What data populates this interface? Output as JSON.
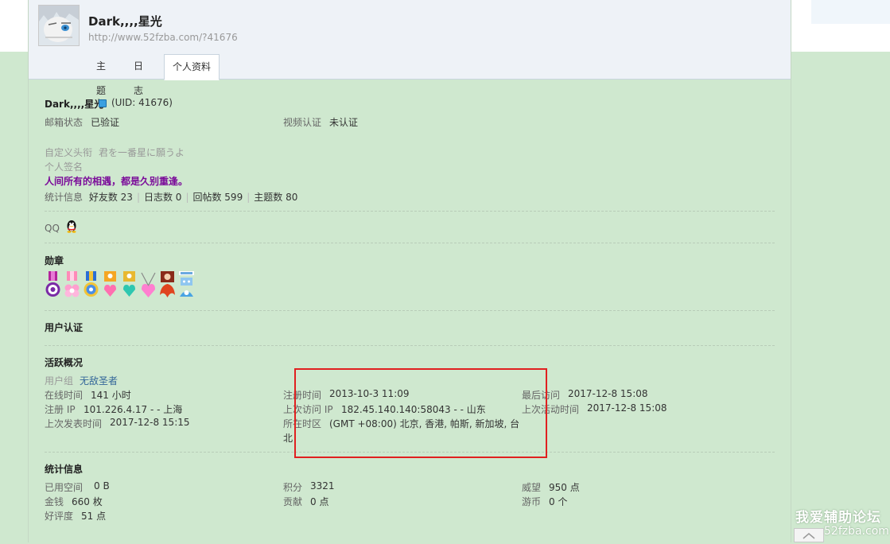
{
  "profile": {
    "name": "Dark,,,,星光",
    "url": "http://www.52fzba.com/?41676",
    "uid_text": "(UID: 41676)"
  },
  "tabs": [
    {
      "label": "主题"
    },
    {
      "label": "日志"
    },
    {
      "label": "个人资料"
    }
  ],
  "info": {
    "email_label": "邮箱状态",
    "email_value": "已验证",
    "video_label": "视频认证",
    "video_value": "未认证",
    "title_label": "自定义头衔",
    "title_value": "君を一番星に願うよ",
    "sig_label": "个人签名",
    "signature": "人间所有的相遇，都是久别重逢。",
    "stats_label": "统计信息",
    "friends": "好友数 23",
    "blogs": "日志数 0",
    "replies": "回帖数 599",
    "threads": "主题数 80",
    "qq_label": "QQ"
  },
  "medals": {
    "heading": "勋章"
  },
  "verify": {
    "heading": "用户认证"
  },
  "activity": {
    "heading": "活跃概况",
    "group_label": "用户组",
    "group_value": "无敌圣者",
    "online_label": "在线时间",
    "online_value": "141 小时",
    "regip_label": "注册 IP",
    "regip_value": "101.226.4.17 - - 上海",
    "lastpost_label": "上次发表时间",
    "lastpost_value": "2017-12-8 15:15",
    "regtime_label": "注册时间",
    "regtime_value": "2013-10-3 11:09",
    "lastip_label": "上次访问 IP",
    "lastip_value": "182.45.140.140:58043 - - 山东",
    "tz_label": "所在时区",
    "tz_value_line1": "(GMT +08:00) 北京, 香港, 帕斯, 新加坡, 台",
    "tz_value_line2": "北",
    "lastvisit_label": "最后访问",
    "lastvisit_value": "2017-12-8 15:08",
    "lastactive_label": "上次活动时间",
    "lastactive_value": "2017-12-8 15:08"
  },
  "stats": {
    "heading": "统计信息",
    "space_label": "已用空间",
    "space_value": "0 B",
    "money_label": "金钱",
    "money_value": "660 枚",
    "rating_label": "好评度",
    "rating_value": "51 点",
    "points_label": "积分",
    "points_value": "3321",
    "contrib_label": "贡献",
    "contrib_value": "0 点",
    "prestige_label": "威望",
    "prestige_value": "950 点",
    "coins_label": "游币",
    "coins_value": "0 个"
  },
  "watermark": {
    "line1": "我爱辅助论坛",
    "line2": "52fzba.com"
  },
  "colors": {
    "page_bg": "#cfe8cf",
    "header_bg": "#eef2f7",
    "signature": "#7a0a99",
    "link": "#336699",
    "highlight_box": "#e02020"
  },
  "icons": {
    "verified": "verified-badge-icon",
    "qq": "qq-penguin-icon",
    "scroll_top": "chevron-up-icon"
  }
}
